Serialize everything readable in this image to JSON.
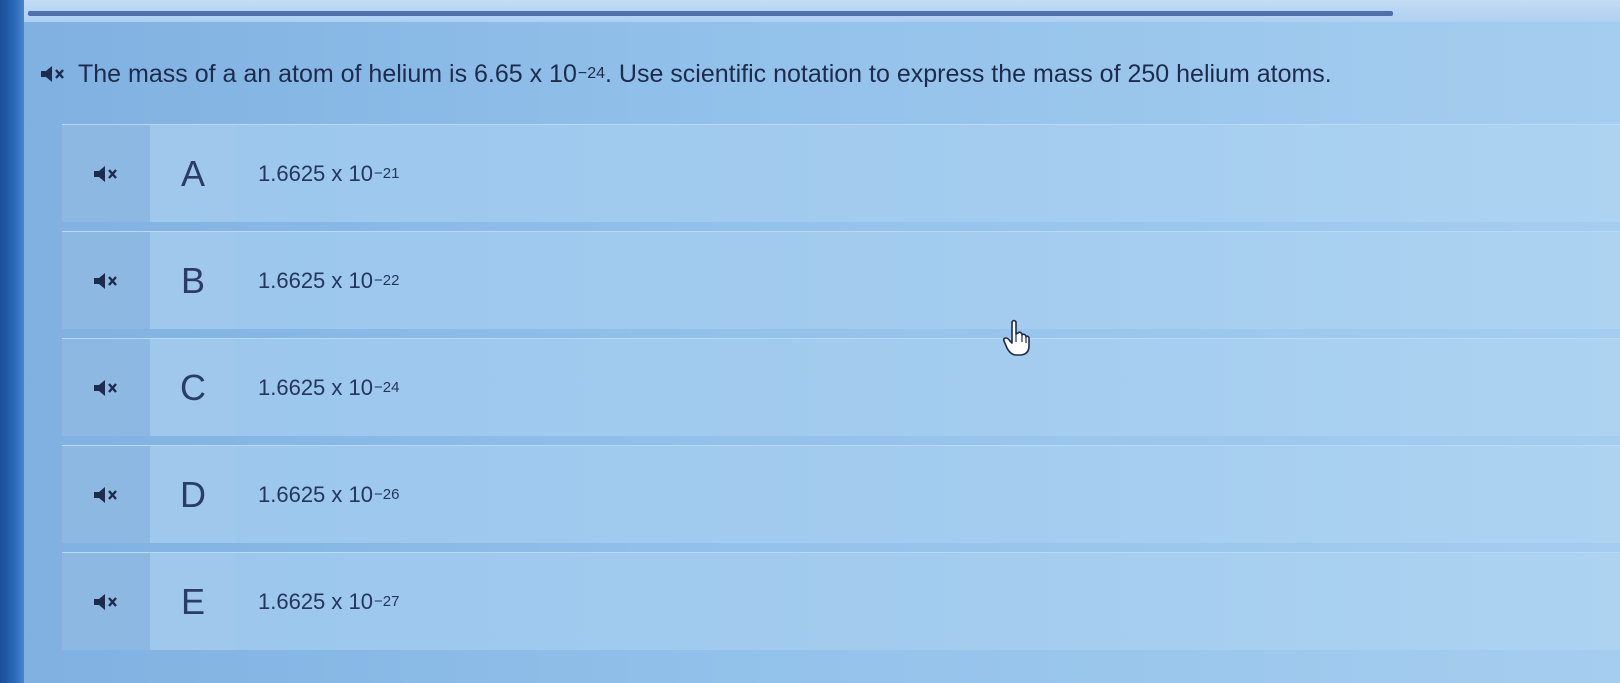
{
  "colors": {
    "text": "#1d2b4d",
    "row_bg": "#a3ccef",
    "speaker_cell_bg": "#8db8e1",
    "bezel": "#2a68b8",
    "top_rule": "#4f6fb0"
  },
  "question": {
    "icon": "speaker-muted-icon",
    "text_before": "The mass of a an atom of helium is 6.65 x 10",
    "exponent": "−24",
    "text_after": ". Use scientific notation to express the mass of 250 helium atoms."
  },
  "answers": [
    {
      "letter": "A",
      "base": "1.6625 x 10",
      "exponent": "−21",
      "icon": "speaker-muted-icon"
    },
    {
      "letter": "B",
      "base": "1.6625 x 10",
      "exponent": "−22",
      "icon": "speaker-muted-icon"
    },
    {
      "letter": "C",
      "base": "1.6625 x 10",
      "exponent": "−24",
      "icon": "speaker-muted-icon"
    },
    {
      "letter": "D",
      "base": "1.6625 x 10",
      "exponent": "−26",
      "icon": "speaker-muted-icon"
    },
    {
      "letter": "E",
      "base": "1.6625 x 10",
      "exponent": "−27",
      "icon": "speaker-muted-icon"
    }
  ],
  "cursor": {
    "icon": "hand-pointer-icon"
  }
}
